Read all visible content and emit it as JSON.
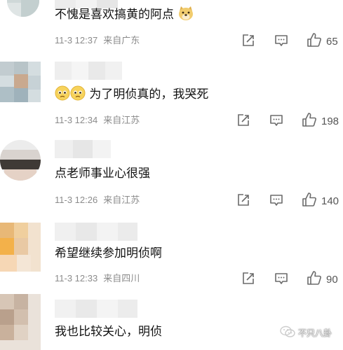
{
  "comments": [
    {
      "text": "不愧是喜欢搞黄的阿点",
      "time": "11-3 12:37",
      "source": "来自广东",
      "likes": "65",
      "text_emoji": "doge-emoji"
    },
    {
      "text": "为了明侦真的，我哭死",
      "time": "11-3 12:34",
      "source": "来自江苏",
      "likes": "198",
      "prefix_emojis": [
        "pleading-face-emoji",
        "pleading-face-emoji"
      ]
    },
    {
      "text": "点老师事业心很强",
      "time": "11-3 12:26",
      "source": "来自江苏",
      "likes": "140"
    },
    {
      "text": "希望继续参加明侦啊",
      "time": "11-3 12:33",
      "source": "来自四川",
      "likes": "90"
    },
    {
      "text": "我也比较关心，明侦"
    }
  ],
  "icons": {
    "repost": "repost-icon",
    "reply": "comment-icon",
    "like": "thumbs-up-icon"
  },
  "watermark": {
    "text": "不只八卦",
    "icon": "wechat-icon"
  },
  "colors": {
    "text": "#111111",
    "meta": "#8b8b8b",
    "icon": "#6b6b6b",
    "background": "#ffffff"
  }
}
